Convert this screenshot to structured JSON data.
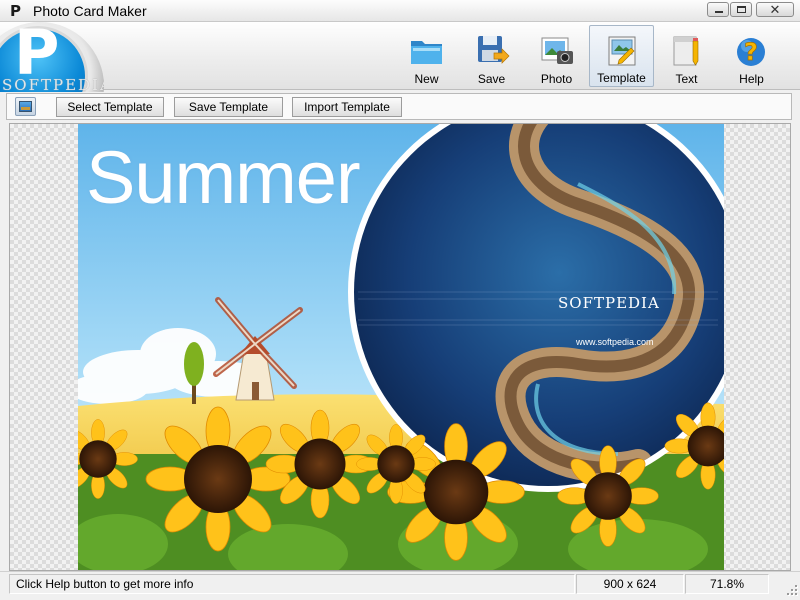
{
  "window": {
    "title": "Photo Card Maker",
    "logo_letter": "P",
    "controls": {
      "minimize": "minimize",
      "maximize": "maximize",
      "close": "✕"
    }
  },
  "app_logo": {
    "letter": "P",
    "watermark": "SOFTPEDIA",
    "watermark_url": "www.softpedia.com"
  },
  "toolbar": {
    "items": [
      {
        "label": "New",
        "icon": "folder-icon"
      },
      {
        "label": "Save",
        "icon": "save-icon"
      },
      {
        "label": "Photo",
        "icon": "photo-icon"
      },
      {
        "label": "Template",
        "icon": "template-icon",
        "active": true
      },
      {
        "label": "Text",
        "icon": "text-icon"
      },
      {
        "label": "Help",
        "icon": "help-icon"
      }
    ]
  },
  "subtoolbar": {
    "icon": "template-preview-icon",
    "select_template": "Select Template",
    "save_template": "Save Template",
    "import_template": "Import Template"
  },
  "card": {
    "title": "Summer",
    "watermark": "SOFTPEDIA",
    "watermark_url": "www.softpedia.com"
  },
  "status": {
    "message": "Click Help button to get more info",
    "dimensions": "900 x 624",
    "zoom": "71.8%"
  },
  "colors": {
    "accent_blue": "#0a88d6",
    "sky": "#7ec3ef",
    "field": "#f2c12e",
    "sunflower": "#ffc21a"
  }
}
